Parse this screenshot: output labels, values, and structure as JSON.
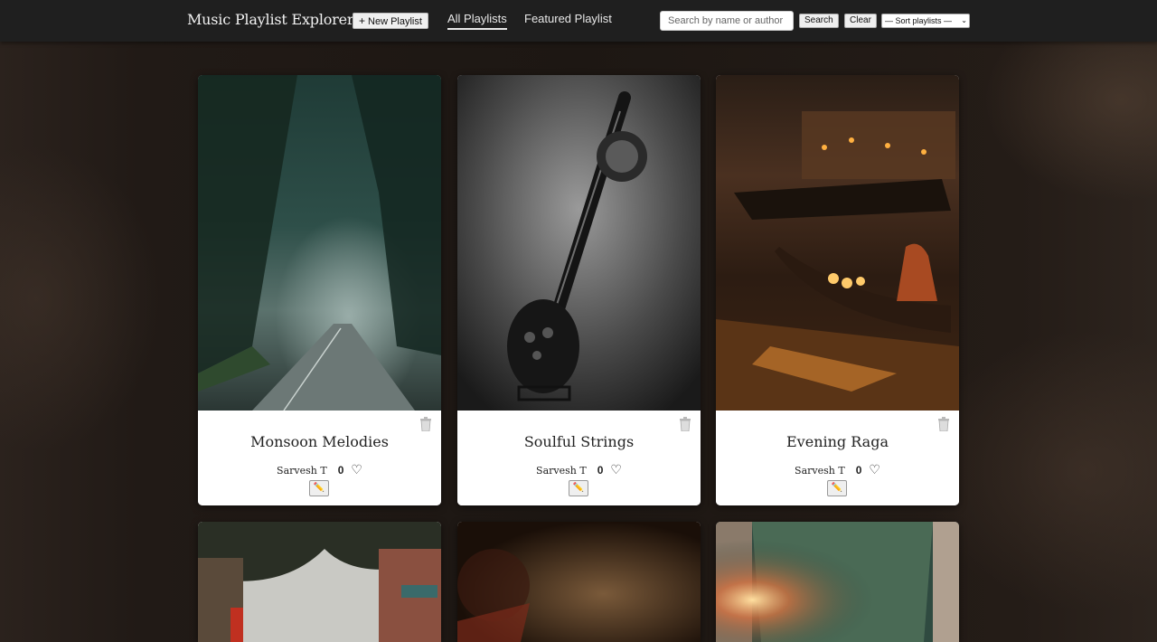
{
  "header": {
    "brand": "Music Playlist Explorer",
    "new_playlist_label": "New Playlist",
    "tabs": [
      {
        "label": "All Playlists",
        "active": true
      },
      {
        "label": "Featured Playlist",
        "active": false
      }
    ],
    "search_placeholder": "Search by name or author",
    "search_value": "",
    "search_button": "Search",
    "clear_button": "Clear",
    "sort_selected": "— Sort playlists —"
  },
  "icons": {
    "new": "plus-icon",
    "delete": "trash-icon",
    "edit": "pencil-icon",
    "like": "heart-icon"
  },
  "playlists": [
    {
      "title": "Monsoon Melodies",
      "author": "Sarvesh T",
      "likes": "0",
      "edit_glyph": "✏️"
    },
    {
      "title": "Soulful Strings",
      "author": "Sarvesh T",
      "likes": "0",
      "edit_glyph": "✏️"
    },
    {
      "title": "Evening Raga",
      "author": "Sarvesh T",
      "likes": "0",
      "edit_glyph": "✏️"
    }
  ],
  "colors": {
    "topbar": "#1f1f1f",
    "background": "#1d1713",
    "card": "#ffffff"
  }
}
